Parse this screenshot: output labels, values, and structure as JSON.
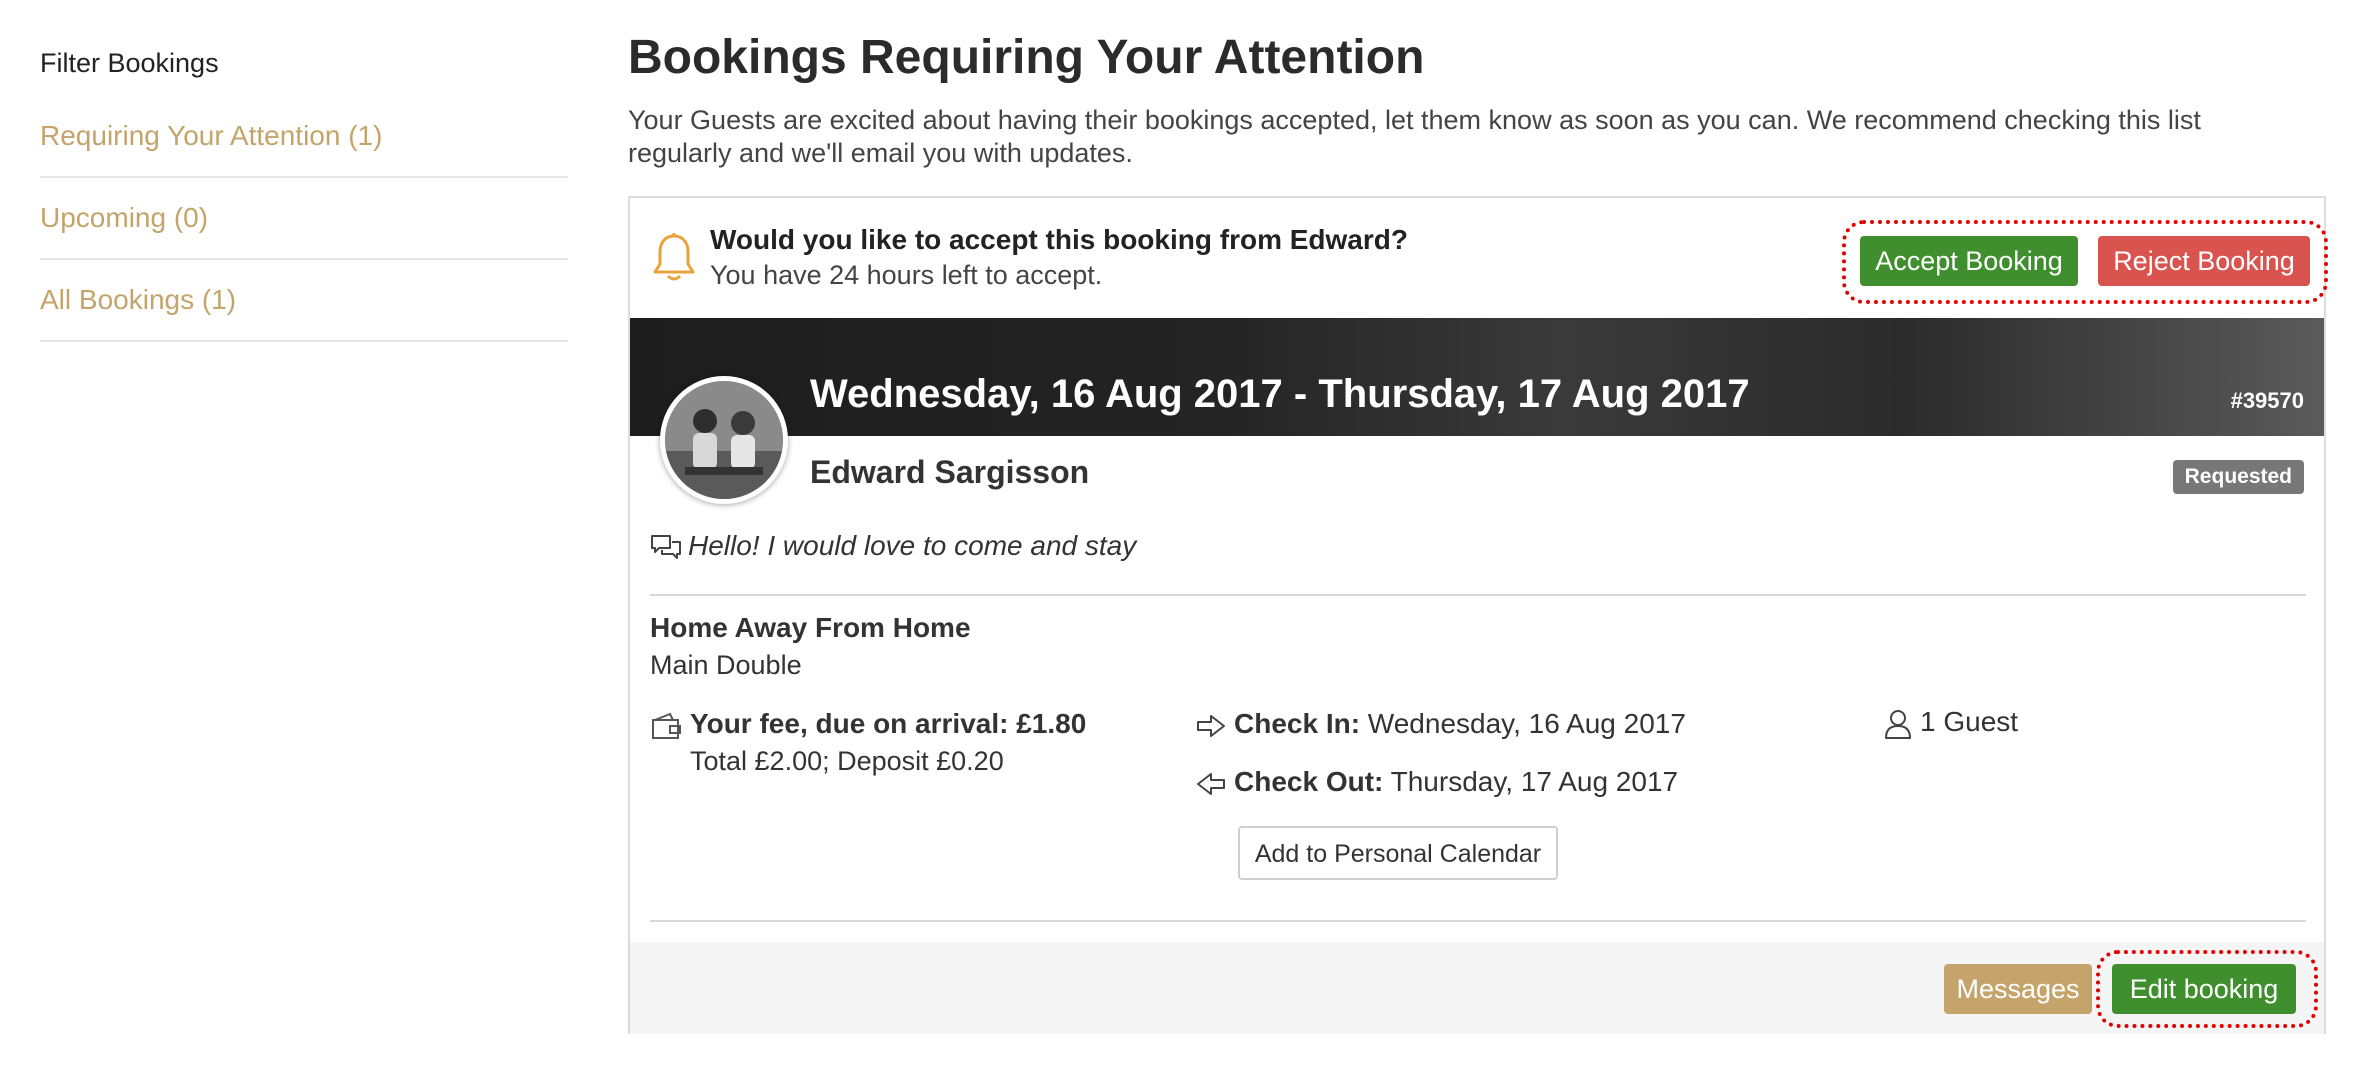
{
  "sidebar": {
    "heading": "Filter Bookings",
    "items": [
      {
        "label": "Requiring Your Attention (1)"
      },
      {
        "label": "Upcoming (0)"
      },
      {
        "label": "All Bookings (1)"
      }
    ]
  },
  "main": {
    "title": "Bookings Requiring Your Attention",
    "description": "Your Guests are excited about having their bookings accepted, let them know as soon as you can. We recommend checking this list regularly and we'll email you with updates."
  },
  "booking": {
    "alert_title": "Would you like to accept this booking from Edward?",
    "alert_subtitle": "You have 24 hours left to accept.",
    "accept_label": "Accept Booking",
    "reject_label": "Reject Booking",
    "date_range": "Wednesday, 16 Aug 2017 - Thursday, 17 Aug 2017",
    "reference": "#39570",
    "guest_name": "Edward Sargisson",
    "status": "Requested",
    "message": "Hello! I would love to come and stay",
    "property_name": "Home Away From Home",
    "room_name": "Main Double",
    "fee_label": "Your fee, due on arrival: £1.80",
    "fee_details": "Total £2.00; Deposit £0.20",
    "checkin_label": "Check In:",
    "checkin_value": " Wednesday, 16 Aug 2017",
    "checkout_label": "Check Out:",
    "checkout_value": " Thursday, 17 Aug 2017",
    "guests": "1 Guest",
    "calendar_label": "Add to Personal Calendar",
    "messages_label": "Messages",
    "edit_label": "Edit booking"
  },
  "icons": {
    "alert": "bell-icon",
    "message": "chat-bubbles-icon",
    "fee": "wallet-icon",
    "checkin": "arrow-right-icon",
    "checkout": "arrow-left-icon",
    "guests": "person-icon"
  },
  "colors": {
    "link_gold": "#c4a46a",
    "accept_green": "#3f8f2e",
    "reject_red": "#d9534f",
    "badge_gray": "#777777",
    "bell_orange": "#e8a33a",
    "annotation_red": "#e00000"
  }
}
